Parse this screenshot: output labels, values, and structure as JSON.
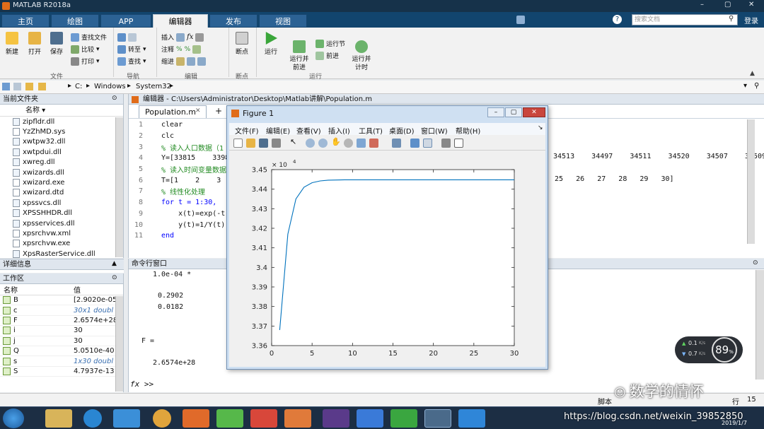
{
  "app": {
    "title": "MATLAB R2018a"
  },
  "main_tabs": [
    {
      "label": "主页"
    },
    {
      "label": "绘图"
    },
    {
      "label": "APP"
    },
    {
      "label": "编辑器"
    },
    {
      "label": "发布"
    },
    {
      "label": "视图"
    }
  ],
  "search": {
    "placeholder": "搜索文档",
    "login": "登录"
  },
  "ribbon": {
    "file_buttons": [
      "新建",
      "打开",
      "保存"
    ],
    "file_small": [
      "查找文件",
      "比较",
      "打印"
    ],
    "nav_small": [
      "转至",
      "查找"
    ],
    "edit_small": [
      "插入",
      "注释",
      "缩进"
    ],
    "breakpoint": "断点",
    "run": [
      "运行",
      "运行并\n前进",
      "运行节",
      "前进",
      "运行并\n计时"
    ],
    "groups": [
      "文件",
      "导航",
      "编辑",
      "断点",
      "运行"
    ]
  },
  "address": {
    "segments": [
      "C:",
      "Windows",
      "System32"
    ]
  },
  "current_folder": {
    "title": "当前文件夹",
    "column": "名称",
    "files": [
      "zipfldr.dll",
      "YzZhMD.sys",
      "xwtpw32.dll",
      "xwtpdui.dll",
      "xwreg.dll",
      "xwizards.dll",
      "xwizard.exe",
      "xwizard.dtd",
      "xpssvcs.dll",
      "XPSSHHDR.dll",
      "xpsservices.dll",
      "xpsrchvw.xml",
      "xpsrchvw.exe",
      "XpsRasterService.dll"
    ]
  },
  "details": {
    "title": "详细信息"
  },
  "workspace": {
    "title": "工作区",
    "col_name": "名称",
    "col_value": "值",
    "rows": [
      {
        "name": "B",
        "value": "[2.9020e-05"
      },
      {
        "name": "c",
        "value": "30x1 doubl"
      },
      {
        "name": "F",
        "value": "2.6574e+28"
      },
      {
        "name": "i",
        "value": "30"
      },
      {
        "name": "j",
        "value": "30"
      },
      {
        "name": "Q",
        "value": "5.0510e-40"
      },
      {
        "name": "s",
        "value": "1x30 doubl"
      },
      {
        "name": "S",
        "value": "4.7937e-13"
      }
    ]
  },
  "editor": {
    "title": "编辑器 - C:\\Users\\Administrator\\Desktop\\Matlab讲解\\Population.m",
    "tab": "Population.m",
    "lines": [
      {
        "n": "1",
        "text": "clear"
      },
      {
        "n": "2",
        "text": "clc"
      },
      {
        "n": "3",
        "text": "% 读入人口数据（1"
      },
      {
        "n": "4",
        "text": "Y=[33815    3398"
      },
      {
        "n": "5",
        "text": "% 读入时间变量数据"
      },
      {
        "n": "6",
        "text": "T=[1    2    3    4"
      },
      {
        "n": "7",
        "text": "% 线性化处理"
      },
      {
        "n": "8",
        "text": "for t = 1:30,"
      },
      {
        "n": "9",
        "text": "    x(t)=exp(-t);"
      },
      {
        "n": "10",
        "text": "    y(t)=1/Y(t);"
      },
      {
        "n": "11",
        "text": "end"
      }
    ],
    "line4_tail": "34513    34497    34511    34520    34507    34509    3",
    "line6_tail": "25   26   27   28   29   30]"
  },
  "command_window": {
    "title": "命令行窗口",
    "lines": [
      "1.0e-04 *",
      "0.2902",
      "0.0182",
      "F =",
      "2.6574e+28"
    ],
    "prompt": "fx >>"
  },
  "figure": {
    "title": "Figure 1",
    "menu": [
      "文件(F)",
      "编辑(E)",
      "查看(V)",
      "插入(I)",
      "工具(T)",
      "桌面(D)",
      "窗口(W)",
      "帮助(H)"
    ]
  },
  "chart_data": {
    "type": "line",
    "title": "",
    "xlabel": "",
    "ylabel": "",
    "xlim": [
      0,
      30
    ],
    "ylim": [
      3.36,
      3.45
    ],
    "y_multiplier_label": "× 10",
    "y_multiplier_exp": "4",
    "xticks": [
      "0",
      "5",
      "10",
      "15",
      "20",
      "25",
      "30"
    ],
    "yticks": [
      "3.36",
      "3.37",
      "3.38",
      "3.39",
      "3.4",
      "3.41",
      "3.42",
      "3.43",
      "3.44",
      "3.45"
    ],
    "x": [
      1,
      2,
      3,
      4,
      5,
      6,
      7,
      8,
      9,
      10,
      11,
      12,
      13,
      14,
      15,
      16,
      17,
      18,
      19,
      20,
      21,
      22,
      23,
      24,
      25,
      26,
      27,
      28,
      29,
      30
    ],
    "y": [
      3.368,
      3.417,
      3.435,
      3.441,
      3.4433,
      3.4442,
      3.4446,
      3.4447,
      3.4448,
      3.4448,
      3.4448,
      3.4448,
      3.4448,
      3.4448,
      3.4448,
      3.4448,
      3.4448,
      3.4448,
      3.4448,
      3.4448,
      3.4448,
      3.4448,
      3.4448,
      3.4448,
      3.4448,
      3.4448,
      3.4448,
      3.4448,
      3.4448,
      3.4448
    ],
    "color": "#0072bd",
    "grid": false
  },
  "net_widget": {
    "up": "0.1",
    "down": "0.7",
    "unit": "K/s",
    "percent": "89",
    "pct_sign": "%"
  },
  "status": {
    "mode": "脚本",
    "row_label": "行",
    "row": "15"
  },
  "watermark": {
    "text": "数学的情怀",
    "url": "https://blog.csdn.net/weixin_39852850"
  },
  "clock": {
    "date": "2019/1/7"
  },
  "colors": {
    "title_bar": "#16324a",
    "tab_bar": "#12456e",
    "accent": "#2c6294"
  }
}
